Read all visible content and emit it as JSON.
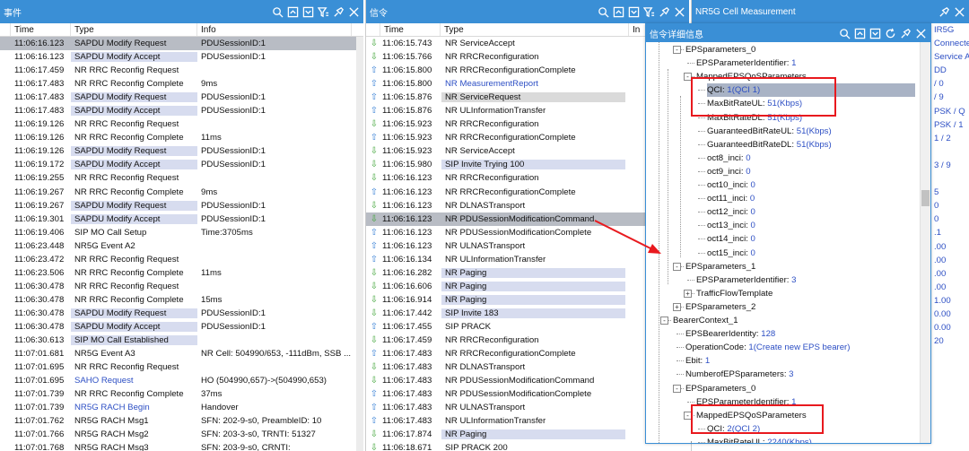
{
  "event_panel": {
    "title": "事件",
    "columns": [
      "Time",
      "Type",
      "Info"
    ],
    "rows": [
      {
        "time": "11:06:16.123",
        "type": "SAPDU Modify Request",
        "info": "PDUSessionID:1",
        "sel": true,
        "hl": true
      },
      {
        "time": "11:06:16.123",
        "type": "SAPDU Modify Accept",
        "info": "PDUSessionID:1",
        "hl": true
      },
      {
        "time": "11:06:17.459",
        "type": "NR RRC Reconfig Request",
        "info": ""
      },
      {
        "time": "11:06:17.483",
        "type": "NR RRC Reconfig Complete",
        "info": "9ms"
      },
      {
        "time": "11:06:17.483",
        "type": "SAPDU Modify Request",
        "info": "PDUSessionID:1",
        "hl": true
      },
      {
        "time": "11:06:17.483",
        "type": "SAPDU Modify Accept",
        "info": "PDUSessionID:1",
        "hl": true
      },
      {
        "time": "11:06:19.126",
        "type": "NR RRC Reconfig Request",
        "info": ""
      },
      {
        "time": "11:06:19.126",
        "type": "NR RRC Reconfig Complete",
        "info": "11ms"
      },
      {
        "time": "11:06:19.126",
        "type": "SAPDU Modify Request",
        "info": "PDUSessionID:1",
        "hl": true
      },
      {
        "time": "11:06:19.172",
        "type": "SAPDU Modify Accept",
        "info": "PDUSessionID:1",
        "hl": true
      },
      {
        "time": "11:06:19.255",
        "type": "NR RRC Reconfig Request",
        "info": ""
      },
      {
        "time": "11:06:19.267",
        "type": "NR RRC Reconfig Complete",
        "info": "9ms"
      },
      {
        "time": "11:06:19.267",
        "type": "SAPDU Modify Request",
        "info": "PDUSessionID:1",
        "hl": true
      },
      {
        "time": "11:06:19.301",
        "type": "SAPDU Modify Accept",
        "info": "PDUSessionID:1",
        "hl": true
      },
      {
        "time": "11:06:19.406",
        "type": "SIP MO Call Setup",
        "info": "Time:3705ms"
      },
      {
        "time": "11:06:23.448",
        "type": "NR5G Event A2",
        "info": ""
      },
      {
        "time": "11:06:23.472",
        "type": "NR RRC Reconfig Request",
        "info": ""
      },
      {
        "time": "11:06:23.506",
        "type": "NR RRC Reconfig Complete",
        "info": "11ms"
      },
      {
        "time": "11:06:30.478",
        "type": "NR RRC Reconfig Request",
        "info": ""
      },
      {
        "time": "11:06:30.478",
        "type": "NR RRC Reconfig Complete",
        "info": "15ms"
      },
      {
        "time": "11:06:30.478",
        "type": "SAPDU Modify Request",
        "info": "PDUSessionID:1",
        "hl": true
      },
      {
        "time": "11:06:30.478",
        "type": "SAPDU Modify Accept",
        "info": "PDUSessionID:1",
        "hl": true
      },
      {
        "time": "11:06:30.613",
        "type": "SIP MO Call Established",
        "info": "",
        "hl": true
      },
      {
        "time": "11:07:01.681",
        "type": "NR5G Event A3",
        "info": "NR Cell: 504990/653, -111dBm, SSB ..."
      },
      {
        "time": "11:07:01.695",
        "type": "NR RRC Reconfig Request",
        "info": ""
      },
      {
        "time": "11:07:01.695",
        "type": "SAHO Request",
        "info": "HO  (504990,657)->(504990,653)",
        "blue": true
      },
      {
        "time": "11:07:01.739",
        "type": "NR RRC Reconfig Complete",
        "info": "37ms"
      },
      {
        "time": "11:07:01.739",
        "type": "NR5G RACH Begin",
        "info": "Handover",
        "blue": true
      },
      {
        "time": "11:07:01.762",
        "type": "NR5G RACH Msg1",
        "info": "SFN: 202-9-s0, PreambleID: 10"
      },
      {
        "time": "11:07:01.766",
        "type": "NR5G RACH Msg2",
        "info": "SFN: 203-3-s0, TRNTI: 51327"
      },
      {
        "time": "11:07:01.768",
        "type": "NR5G RACH Msg3",
        "info": "SFN: 203-9-s0, CRNTI: "
      }
    ]
  },
  "signal_panel": {
    "title": "信令",
    "columns": [
      "Time",
      "Type",
      "In"
    ],
    "rows": [
      {
        "d": "dn",
        "time": "11:06:15.743",
        "type": "NR ServiceAccept"
      },
      {
        "d": "dn",
        "time": "11:06:15.766",
        "type": "NR RRCReconfiguration"
      },
      {
        "d": "up",
        "time": "11:06:15.800",
        "type": "NR RRCReconfigurationComplete"
      },
      {
        "d": "up",
        "time": "11:06:15.800",
        "type": "NR MeasurementReport",
        "blue": true
      },
      {
        "d": "up",
        "time": "11:06:15.876",
        "type": "NR ServiceRequest",
        "grey": true
      },
      {
        "d": "up",
        "time": "11:06:15.876",
        "type": "NR ULInformationTransfer"
      },
      {
        "d": "dn",
        "time": "11:06:15.923",
        "type": "NR RRCReconfiguration"
      },
      {
        "d": "up",
        "time": "11:06:15.923",
        "type": "NR RRCReconfigurationComplete"
      },
      {
        "d": "dn",
        "time": "11:06:15.923",
        "type": "NR ServiceAccept"
      },
      {
        "d": "dn",
        "time": "11:06:15.980",
        "type": "SIP Invite Trying 100",
        "hl": true
      },
      {
        "d": "dn",
        "time": "11:06:16.123",
        "type": "NR RRCReconfiguration"
      },
      {
        "d": "up",
        "time": "11:06:16.123",
        "type": "NR RRCReconfigurationComplete"
      },
      {
        "d": "dn",
        "time": "11:06:16.123",
        "type": "NR DLNASTransport"
      },
      {
        "d": "dn",
        "time": "11:06:16.123",
        "type": "NR PDUSessionModificationCommand",
        "sel": true
      },
      {
        "d": "up",
        "time": "11:06:16.123",
        "type": "NR PDUSessionModificationComplete"
      },
      {
        "d": "up",
        "time": "11:06:16.123",
        "type": "NR ULNASTransport"
      },
      {
        "d": "up",
        "time": "11:06:16.134",
        "type": "NR ULInformationTransfer"
      },
      {
        "d": "dn",
        "time": "11:06:16.282",
        "type": "NR Paging",
        "hl": true
      },
      {
        "d": "dn",
        "time": "11:06:16.606",
        "type": "NR Paging",
        "hl": true
      },
      {
        "d": "dn",
        "time": "11:06:16.914",
        "type": "NR Paging",
        "hl": true
      },
      {
        "d": "dn",
        "time": "11:06:17.442",
        "type": "SIP Invite 183",
        "hl": true
      },
      {
        "d": "up",
        "time": "11:06:17.455",
        "type": "SIP PRACK"
      },
      {
        "d": "dn",
        "time": "11:06:17.459",
        "type": "NR RRCReconfiguration"
      },
      {
        "d": "up",
        "time": "11:06:17.483",
        "type": "NR RRCReconfigurationComplete"
      },
      {
        "d": "dn",
        "time": "11:06:17.483",
        "type": "NR DLNASTransport"
      },
      {
        "d": "dn",
        "time": "11:06:17.483",
        "type": "NR PDUSessionModificationCommand"
      },
      {
        "d": "up",
        "time": "11:06:17.483",
        "type": "NR PDUSessionModificationComplete"
      },
      {
        "d": "up",
        "time": "11:06:17.483",
        "type": "NR ULNASTransport"
      },
      {
        "d": "up",
        "time": "11:06:17.483",
        "type": "NR ULInformationTransfer"
      },
      {
        "d": "dn",
        "time": "11:06:17.874",
        "type": "NR Paging",
        "hl": true
      },
      {
        "d": "dn",
        "time": "11:06:18.671",
        "type": "SIP PRACK 200"
      }
    ]
  },
  "cell_panel": {
    "title": "NR5G Cell Measurement",
    "values": [
      "IR5G",
      "Connecte",
      "Service A",
      "DD",
      "/ 0",
      "/ 9",
      "PSK / Q",
      "PSK / 1",
      "1 / 2",
      "",
      "3 / 9",
      "",
      "5",
      "0",
      "0",
      ".1",
      ".00",
      ".00",
      ".00",
      ".00",
      "1.00",
      "0.00",
      "0.00",
      "20"
    ]
  },
  "detail_popup": {
    "title": "信令详细信息",
    "nodes": [
      {
        "t": "EPSparameters_0",
        "l": 3,
        "exp": "-"
      },
      {
        "t": "EPSParameterIdentifier: ",
        "v": "1",
        "l": 4
      },
      {
        "t": "MappedEPSQoSParameters",
        "l": 4,
        "exp": "-"
      },
      {
        "t": "QCI: ",
        "v": "1(QCI 1)",
        "l": 5,
        "sel": true
      },
      {
        "t": "MaxBitRateUL: ",
        "v": "51(Kbps)",
        "l": 5
      },
      {
        "t": "MaxBitRateDL: ",
        "v": "51(Kbps)",
        "l": 5
      },
      {
        "t": "GuaranteedBitRateUL: ",
        "v": "51(Kbps)",
        "l": 5
      },
      {
        "t": "GuaranteedBitRateDL: ",
        "v": "51(Kbps)",
        "l": 5
      },
      {
        "t": "oct8_inci: ",
        "v": "0",
        "l": 5
      },
      {
        "t": "oct9_inci: ",
        "v": "0",
        "l": 5
      },
      {
        "t": "oct10_inci: ",
        "v": "0",
        "l": 5
      },
      {
        "t": "oct11_inci: ",
        "v": "0",
        "l": 5
      },
      {
        "t": "oct12_inci: ",
        "v": "0",
        "l": 5
      },
      {
        "t": "oct13_inci: ",
        "v": "0",
        "l": 5
      },
      {
        "t": "oct14_inci: ",
        "v": "0",
        "l": 5
      },
      {
        "t": "oct15_inci: ",
        "v": "0",
        "l": 5
      },
      {
        "t": "EPSparameters_1",
        "l": 3,
        "exp": "-"
      },
      {
        "t": "EPSParameterIdentifier: ",
        "v": "3",
        "l": 4
      },
      {
        "t": "TrafficFlowTemplate",
        "l": 4,
        "exp": "+"
      },
      {
        "t": "EPSparameters_2",
        "l": 3,
        "exp": "+"
      },
      {
        "t": "BearerContext_1",
        "l": 2,
        "exp": "-"
      },
      {
        "t": "EPSBearerIdentity: ",
        "v": "128",
        "l": 3
      },
      {
        "t": "OperationCode: ",
        "v": "1(Create new EPS bearer)",
        "l": 3
      },
      {
        "t": "Ebit: ",
        "v": "1",
        "l": 3
      },
      {
        "t": "NumberofEPSparameters: ",
        "v": "3",
        "l": 3
      },
      {
        "t": "EPSparameters_0",
        "l": 3,
        "exp": "-"
      },
      {
        "t": "EPSParameterIdentifier: ",
        "v": "1",
        "l": 4
      },
      {
        "t": "MappedEPSQoSParameters",
        "l": 4,
        "exp": "-"
      },
      {
        "t": "QCI: ",
        "v": "2(QCI 2)",
        "l": 5
      },
      {
        "t": "MaxBitRateUL: ",
        "v": "2240(Kbps)",
        "l": 5
      }
    ]
  },
  "colors": {
    "accent": "#3a8fd6",
    "annotation": "#e8191e",
    "selection": "#b8bcc4",
    "highlight": "#d7dcef"
  }
}
